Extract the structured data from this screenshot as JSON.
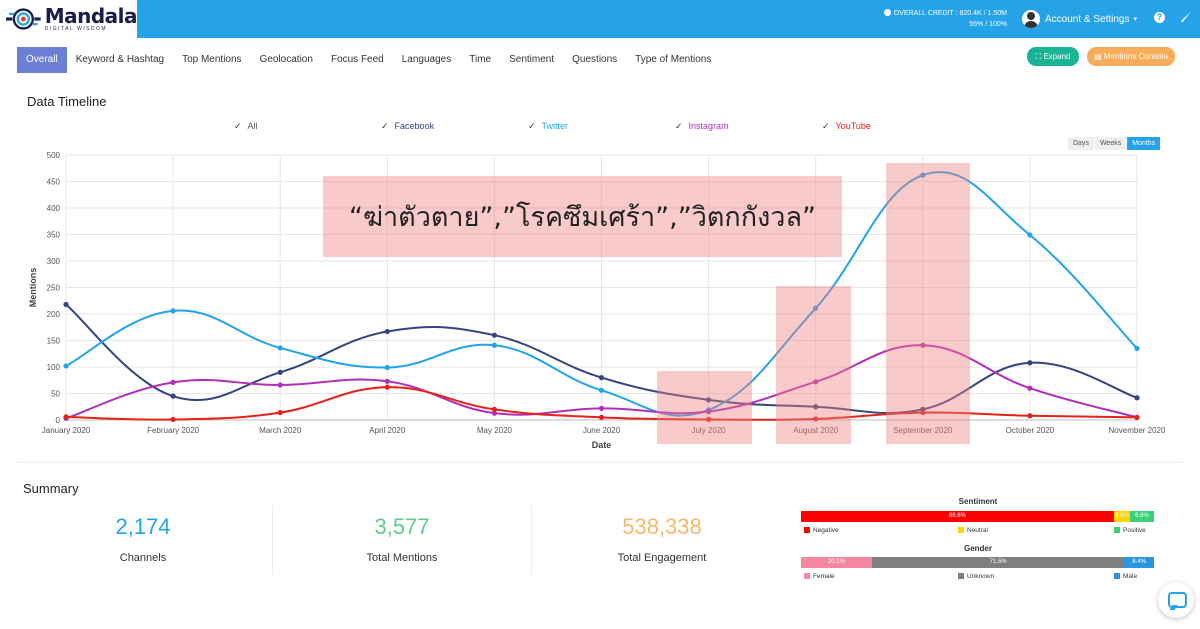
{
  "brand": {
    "name": "Mandala",
    "tagline": "DIGITAL WISDOM"
  },
  "header": {
    "credit_line1": "OVERALL CREDIT : 820.4K / 1.50M",
    "credit_line2": "55% / 100%",
    "account_label": "Account & Settings",
    "help_glyph": "?"
  },
  "tabs": [
    {
      "label": "Overall",
      "active": true
    },
    {
      "label": "Keyword & Hashtag"
    },
    {
      "label": "Top Mentions"
    },
    {
      "label": "Geolocation"
    },
    {
      "label": "Focus Feed"
    },
    {
      "label": "Languages"
    },
    {
      "label": "Time"
    },
    {
      "label": "Sentiment"
    },
    {
      "label": "Questions"
    },
    {
      "label": "Type of Mentions"
    }
  ],
  "buttons": {
    "expand": "Expand",
    "console": "Mentions Console"
  },
  "timeline": {
    "title": "Data Timeline",
    "legend": [
      {
        "label": "All",
        "color": "#555555"
      },
      {
        "label": "Facebook",
        "color": "#34447e"
      },
      {
        "label": "Twitter",
        "color": "#23a3e8"
      },
      {
        "label": "Instagram",
        "color": "#b12fb8"
      },
      {
        "label": "YouTube",
        "color": "#e62117"
      }
    ],
    "ranges": [
      {
        "label": "Days"
      },
      {
        "label": "Weeks"
      },
      {
        "label": "Months",
        "active": true
      }
    ],
    "annotation": "“ฆ่าตัวตาย”,”โรคซึมเศร้า”,”วิตกกังวล”"
  },
  "chart_data": {
    "type": "line",
    "xlabel": "Date",
    "ylabel": "Mentions",
    "ylim": [
      0,
      500
    ],
    "yticks": [
      0,
      50,
      100,
      150,
      200,
      250,
      300,
      350,
      400,
      450,
      500
    ],
    "grid": true,
    "categories": [
      "January 2020",
      "February 2020",
      "March 2020",
      "April 2020",
      "May 2020",
      "June 2020",
      "July 2020",
      "August 2020",
      "September 2020",
      "October 2020",
      "November 2020"
    ],
    "series": [
      {
        "name": "Facebook",
        "color": "#34447e",
        "values": [
          218,
          45,
          90,
          167,
          160,
          80,
          38,
          25,
          20,
          108,
          42
        ]
      },
      {
        "name": "Twitter",
        "color": "#23a3e8",
        "values": [
          102,
          206,
          136,
          99,
          141,
          56,
          19,
          211,
          462,
          349,
          135
        ]
      },
      {
        "name": "Instagram",
        "color": "#b12fb8",
        "values": [
          3,
          71,
          66,
          73,
          13,
          22,
          16,
          72,
          141,
          60,
          5
        ]
      },
      {
        "name": "YouTube",
        "color": "#e62117",
        "values": [
          6,
          1,
          14,
          62,
          20,
          5,
          1,
          2,
          14,
          8,
          5
        ]
      }
    ]
  },
  "summary": {
    "title": "Summary",
    "stats": [
      {
        "value": "2,174",
        "label": "Channels",
        "color": "#23a3e8"
      },
      {
        "value": "3,577",
        "label": "Total Mentions",
        "color": "#5ecb8f"
      },
      {
        "value": "538,338",
        "label": "Total Engagement",
        "color": "#f8b86b"
      }
    ],
    "sentiment": {
      "title": "Sentiment",
      "segments": [
        {
          "label": "Negative",
          "pct": 88.6,
          "text": "88.6%",
          "color": "#ff0000"
        },
        {
          "label": "Neutral",
          "pct": 4.6,
          "text": "4.6%",
          "color": "#ffd400"
        },
        {
          "label": "Positive",
          "pct": 6.8,
          "text": "6.8%",
          "color": "#3ad17a"
        }
      ]
    },
    "gender": {
      "title": "Gender",
      "segments": [
        {
          "label": "Female",
          "pct": 20.1,
          "text": "20.1%",
          "color": "#f587a0"
        },
        {
          "label": "Unknown",
          "pct": 71.5,
          "text": "71.5%",
          "color": "#7f7f7f"
        },
        {
          "label": "Male",
          "pct": 8.4,
          "text": "8.4%",
          "color": "#2996dd"
        }
      ]
    }
  }
}
